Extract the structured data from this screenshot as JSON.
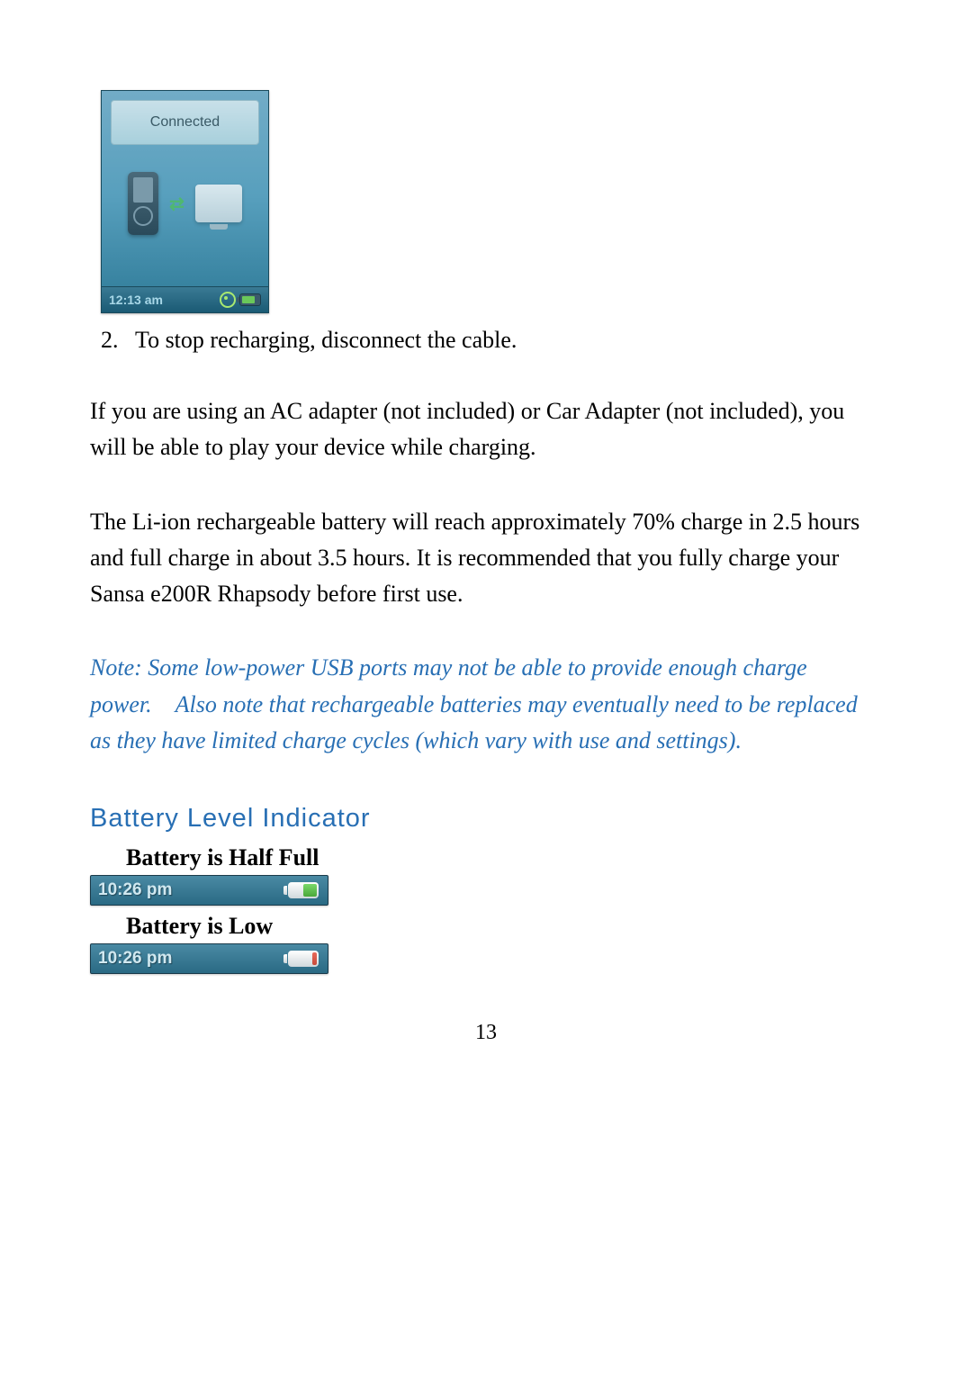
{
  "device_screenshot": {
    "header_label": "Connected",
    "time": "12:13 am"
  },
  "list": {
    "number": "2.",
    "text": "To stop recharging, disconnect the cable."
  },
  "paragraph1": "If you are using an AC adapter (not included) or Car Adapter (not included), you will be able to play your device while charging.",
  "paragraph2": "The Li-ion rechargeable battery will reach approximately 70% charge in 2.5 hours and full charge in about 3.5 hours. It is recommended that you fully charge your Sansa e200R Rhapsody before first use.",
  "note": "Note: Some low-power USB ports may not be able to provide enough charge power.    Also note that rechargeable batteries may eventually need to be replaced as they have limited charge cycles (which vary with use and settings).",
  "section_heading": "Battery Level Indicator",
  "battery_half_label": "Battery is Half Full",
  "battery_half_time": "10:26 pm",
  "battery_low_label": "Battery is Low",
  "battery_low_time": "10:26 pm",
  "page_number": "13"
}
